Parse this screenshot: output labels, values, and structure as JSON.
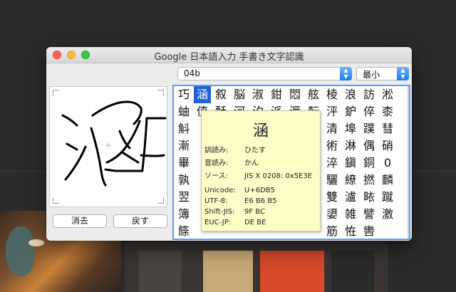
{
  "window": {
    "title": "Google 日本語入力 手書き文字認識"
  },
  "controls": {
    "candidate_text": "04b",
    "mode": "最小"
  },
  "buttons": {
    "clear": "消去",
    "undo": "戻す"
  },
  "candidates": [
    [
      "巧",
      "涵",
      "叙",
      "脳",
      "淑",
      "鉗",
      "悶",
      "舷",
      "棱",
      "浪",
      "訪",
      "淞"
    ],
    [
      "蚰",
      "值",
      "酥",
      "河",
      "汐",
      "派",
      "溽",
      "転",
      "泙",
      "鈩",
      "倅",
      "桼"
    ],
    [
      "斛",
      "",
      "",
      "",
      "",
      "",
      "",
      "",
      "清",
      "埠",
      "蹼",
      "彗"
    ],
    [
      "漸",
      "",
      "",
      "",
      "",
      "",
      "",
      "",
      "術",
      "淋",
      "偶",
      "硝"
    ],
    [
      "畢",
      "",
      "",
      "",
      "",
      "",
      "",
      "",
      "淬",
      "鎭",
      "銅",
      "0"
    ],
    [
      "孰",
      "",
      "",
      "",
      "",
      "",
      "",
      "",
      "驪",
      "繚",
      "撚",
      "麟"
    ],
    [
      "翌",
      "",
      "",
      "",
      "",
      "",
      "",
      "",
      "雙",
      "瀘",
      "畩",
      "蹴"
    ],
    [
      "簿",
      "",
      "",
      "",
      "",
      "",
      "",
      "",
      "嬃",
      "雑",
      "譬",
      "激"
    ],
    [
      "篨",
      "",
      "",
      "",
      "",
      "",
      "",
      "",
      "筋",
      "恠",
      "轡",
      ""
    ]
  ],
  "tooltip": {
    "glyph": "涵",
    "rows": [
      {
        "label": "訓読み:",
        "value": "ひたす"
      },
      {
        "label": "音読み:",
        "value": "かん"
      },
      {
        "label": "ソース:",
        "value": "JIS X 0208: 0x5E3E"
      },
      {
        "label": "Unicode:",
        "value": "U+6DB5"
      },
      {
        "label": "UTF-8:",
        "value": "E6 B6 B5"
      },
      {
        "label": "Shift-JIS:",
        "value": "9F BC"
      },
      {
        "label": "EUC-JP:",
        "value": "DE BE"
      }
    ]
  },
  "colors": {
    "selection": "#1f62d6",
    "focus_ring": "#5b9ef0",
    "tooltip_bg": "#fdfdc8"
  }
}
